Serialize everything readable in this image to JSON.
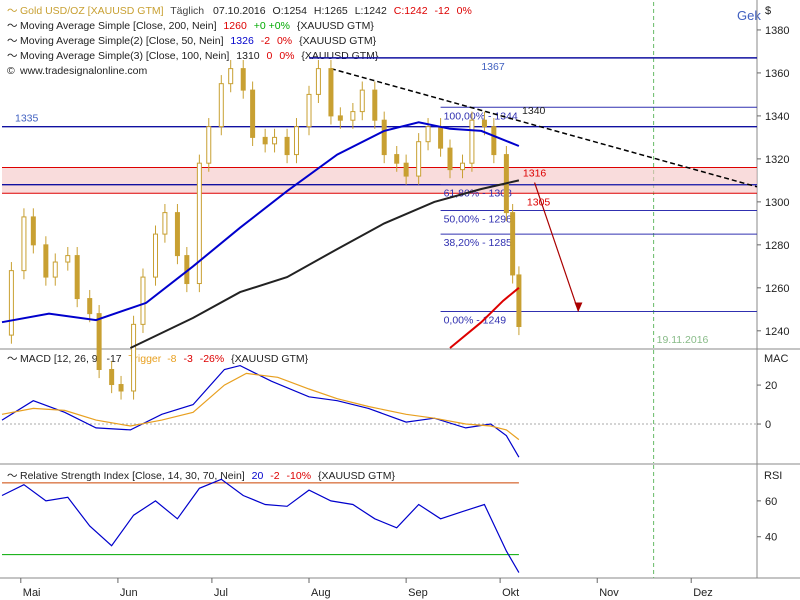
{
  "header": {
    "line1": {
      "name": "Gold USD/OZ [XAUUSD GTM]",
      "meta": "Täglich",
      "date": "07.10.2016",
      "o": "O:1254",
      "h": "H:1265",
      "l": "L:1242",
      "c": "C:1242",
      "chg": "-12",
      "pct": "0%"
    },
    "ma200": {
      "label": "Moving Average Simple [Close, 200, Nein]",
      "value": "1260",
      "chg": "+0",
      "pct": "+0%",
      "src": "{XAUUSD GTM}"
    },
    "ma50": {
      "label": "Moving Average Simple(2) [Close, 50, Nein]",
      "value": "1326",
      "chg": "-2",
      "pct": "0%",
      "src": "{XAUUSD GTM}"
    },
    "ma100": {
      "label": "Moving Average Simple(3) [Close, 100, Nein]",
      "value": "1310",
      "chg": "0",
      "pct": "0%",
      "src": "{XAUUSD GTM}"
    },
    "credit": "www.tradesignalonline.com",
    "corner": "Gek",
    "currency": "$"
  },
  "macd_header": {
    "label": "MACD [12, 26, 9]",
    "value": "-17",
    "trigger_label": "Trigger",
    "trigger": "-8",
    "chg": "-3",
    "pct": "-26%",
    "src": "{XAUUSD GTM}",
    "axis": "MAC"
  },
  "rsi_header": {
    "label": "Relative Strength Index [Close, 14, 30, 70, Nein]",
    "value": "20",
    "chg": "-2",
    "pct": "-10%",
    "src": "{XAUUSD GTM}",
    "axis": "RSI"
  },
  "colors": {
    "candle": "#c8a032",
    "ma50": "#0000cc",
    "ma100": "#222222",
    "ma200": "#dd0000",
    "hline": "#1010a0",
    "fib": "#3030b0",
    "zone": "#f5c4c4",
    "macd": "#0000cc",
    "trigger": "#e8a020",
    "rsi": "#0000cc",
    "vline": "#66bb66"
  },
  "chart_data": [
    {
      "type": "candlestick",
      "price_axis": {
        "ylim": [
          1232,
          1393
        ],
        "ticks": [
          1240,
          1260,
          1280,
          1300,
          1320,
          1340,
          1360,
          1380
        ]
      },
      "time_axis": {
        "xlim": [
          "2016-04-25",
          "2016-12-22"
        ],
        "months": [
          {
            "label": "Mai",
            "date": "2016-05-01"
          },
          {
            "label": "Jun",
            "date": "2016-06-01"
          },
          {
            "label": "Jul",
            "date": "2016-07-01"
          },
          {
            "label": "Aug",
            "date": "2016-08-01"
          },
          {
            "label": "Sep",
            "date": "2016-09-01"
          },
          {
            "label": "Okt",
            "date": "2016-10-01"
          },
          {
            "label": "Nov",
            "date": "2016-11-01"
          },
          {
            "label": "Dez",
            "date": "2016-12-01"
          }
        ]
      },
      "close": [
        [
          "2016-04-25",
          1238
        ],
        [
          "2016-04-28",
          1268
        ],
        [
          "2016-05-02",
          1293
        ],
        [
          "2016-05-05",
          1280
        ],
        [
          "2016-05-09",
          1265
        ],
        [
          "2016-05-12",
          1272
        ],
        [
          "2016-05-16",
          1275
        ],
        [
          "2016-05-19",
          1255
        ],
        [
          "2016-05-23",
          1248
        ],
        [
          "2016-05-26",
          1222
        ],
        [
          "2016-05-30",
          1215
        ],
        [
          "2016-06-02",
          1212
        ],
        [
          "2016-06-06",
          1243
        ],
        [
          "2016-06-09",
          1265
        ],
        [
          "2016-06-13",
          1285
        ],
        [
          "2016-06-16",
          1295
        ],
        [
          "2016-06-20",
          1275
        ],
        [
          "2016-06-23",
          1262
        ],
        [
          "2016-06-27",
          1318
        ],
        [
          "2016-06-30",
          1335
        ],
        [
          "2016-07-04",
          1355
        ],
        [
          "2016-07-07",
          1362
        ],
        [
          "2016-07-11",
          1352
        ],
        [
          "2016-07-14",
          1330
        ],
        [
          "2016-07-18",
          1327
        ],
        [
          "2016-07-21",
          1330
        ],
        [
          "2016-07-25",
          1322
        ],
        [
          "2016-07-28",
          1335
        ],
        [
          "2016-08-01",
          1350
        ],
        [
          "2016-08-04",
          1362
        ],
        [
          "2016-08-08",
          1340
        ],
        [
          "2016-08-11",
          1338
        ],
        [
          "2016-08-15",
          1342
        ],
        [
          "2016-08-18",
          1352
        ],
        [
          "2016-08-22",
          1338
        ],
        [
          "2016-08-25",
          1322
        ],
        [
          "2016-08-29",
          1318
        ],
        [
          "2016-09-01",
          1312
        ],
        [
          "2016-09-05",
          1328
        ],
        [
          "2016-09-08",
          1335
        ],
        [
          "2016-09-12",
          1325
        ],
        [
          "2016-09-15",
          1315
        ],
        [
          "2016-09-19",
          1318
        ],
        [
          "2016-09-22",
          1338
        ],
        [
          "2016-09-26",
          1335
        ],
        [
          "2016-09-29",
          1322
        ],
        [
          "2016-10-03",
          1295
        ],
        [
          "2016-10-05",
          1266
        ],
        [
          "2016-10-07",
          1242
        ]
      ],
      "series": [
        {
          "name": "Moving Average Simple(2) [Close, 50, Nein]",
          "points": [
            [
              "2016-04-25",
              1244
            ],
            [
              "2016-05-10",
              1248
            ],
            [
              "2016-05-25",
              1245
            ],
            [
              "2016-06-10",
              1253
            ],
            [
              "2016-06-25",
              1270
            ],
            [
              "2016-07-10",
              1288
            ],
            [
              "2016-07-25",
              1305
            ],
            [
              "2016-08-10",
              1322
            ],
            [
              "2016-08-25",
              1333
            ],
            [
              "2016-09-05",
              1337
            ],
            [
              "2016-09-15",
              1334
            ],
            [
              "2016-09-25",
              1333
            ],
            [
              "2016-10-07",
              1326
            ]
          ]
        },
        {
          "name": "Moving Average Simple(3) [Close, 100, Nein]",
          "points": [
            [
              "2016-06-05",
              1232
            ],
            [
              "2016-06-25",
              1246
            ],
            [
              "2016-07-10",
              1258
            ],
            [
              "2016-07-25",
              1265
            ],
            [
              "2016-08-10",
              1278
            ],
            [
              "2016-08-25",
              1290
            ],
            [
              "2016-09-10",
              1300
            ],
            [
              "2016-09-25",
              1306
            ],
            [
              "2016-10-07",
              1310
            ]
          ]
        },
        {
          "name": "Moving Average Simple [Close, 200, Nein]",
          "points": [
            [
              "2016-09-15",
              1232
            ],
            [
              "2016-09-25",
              1244
            ],
            [
              "2016-10-02",
              1254
            ],
            [
              "2016-10-07",
              1260
            ]
          ]
        }
      ],
      "levels": [
        {
          "label": "1367",
          "value": 1367,
          "color": "#1010a0"
        },
        {
          "label": "1335",
          "value": 1335,
          "color": "#1010a0"
        },
        {
          "label": "1308",
          "value": 1308,
          "color": "#1010a0"
        }
      ],
      "zone": {
        "from": 1304,
        "to": 1316,
        "labels": [
          "1316",
          "1305"
        ]
      },
      "fib": [
        {
          "label": "100,00% - 1344",
          "value": 1344
        },
        {
          "label": "61,80% - 1308",
          "value": 1308
        },
        {
          "label": "50,00% - 1296",
          "value": 1296
        },
        {
          "label": "38,20% - 1285",
          "value": 1285
        },
        {
          "label": "0,00% - 1249",
          "value": 1249
        }
      ],
      "fib_extra_label": "1340",
      "trendline": {
        "from": [
          "2016-08-08",
          1362
        ],
        "to": [
          "2016-12-22",
          1307
        ]
      },
      "arrow": {
        "from": [
          "2016-10-12",
          1309
        ],
        "to": [
          "2016-10-26",
          1249
        ]
      },
      "vline": {
        "date": "2016-11-19",
        "label": "19.11.2016"
      }
    },
    {
      "type": "line",
      "title": "MACD [12, 26, 9]",
      "ylim": [
        -20,
        38
      ],
      "ticks": [
        0,
        20
      ],
      "series": [
        {
          "name": "MACD",
          "points": [
            [
              "2016-04-25",
              2
            ],
            [
              "2016-05-05",
              12
            ],
            [
              "2016-05-15",
              6
            ],
            [
              "2016-05-25",
              -2
            ],
            [
              "2016-06-05",
              -3
            ],
            [
              "2016-06-15",
              5
            ],
            [
              "2016-06-25",
              10
            ],
            [
              "2016-07-05",
              28
            ],
            [
              "2016-07-10",
              30
            ],
            [
              "2016-07-20",
              22
            ],
            [
              "2016-08-01",
              14
            ],
            [
              "2016-08-10",
              12
            ],
            [
              "2016-08-20",
              8
            ],
            [
              "2016-09-01",
              1
            ],
            [
              "2016-09-10",
              3
            ],
            [
              "2016-09-20",
              -2
            ],
            [
              "2016-09-28",
              0
            ],
            [
              "2016-10-03",
              -6
            ],
            [
              "2016-10-07",
              -17
            ]
          ]
        },
        {
          "name": "Trigger",
          "points": [
            [
              "2016-04-25",
              5
            ],
            [
              "2016-05-05",
              8
            ],
            [
              "2016-05-15",
              7
            ],
            [
              "2016-05-25",
              2
            ],
            [
              "2016-06-05",
              -1
            ],
            [
              "2016-06-15",
              2
            ],
            [
              "2016-06-25",
              6
            ],
            [
              "2016-07-05",
              20
            ],
            [
              "2016-07-12",
              26
            ],
            [
              "2016-07-22",
              24
            ],
            [
              "2016-08-01",
              18
            ],
            [
              "2016-08-10",
              13
            ],
            [
              "2016-08-20",
              9
            ],
            [
              "2016-09-01",
              5
            ],
            [
              "2016-09-10",
              3
            ],
            [
              "2016-09-20",
              0
            ],
            [
              "2016-09-28",
              -1
            ],
            [
              "2016-10-03",
              -3
            ],
            [
              "2016-10-07",
              -8
            ]
          ]
        }
      ]
    },
    {
      "type": "line",
      "title": "Relative Strength Index [Close, 14, 30, 70, Nein]",
      "ylim": [
        17,
        80
      ],
      "ticks": [
        40,
        60
      ],
      "levels": [
        {
          "value": 70,
          "color": "#cc4400"
        },
        {
          "value": 30,
          "color": "#00aa00"
        }
      ],
      "series": [
        {
          "name": "RSI",
          "points": [
            [
              "2016-04-25",
              63
            ],
            [
              "2016-05-02",
              69
            ],
            [
              "2016-05-09",
              60
            ],
            [
              "2016-05-16",
              62
            ],
            [
              "2016-05-23",
              46
            ],
            [
              "2016-05-30",
              35
            ],
            [
              "2016-06-06",
              52
            ],
            [
              "2016-06-13",
              60
            ],
            [
              "2016-06-20",
              50
            ],
            [
              "2016-06-27",
              67
            ],
            [
              "2016-07-04",
              72
            ],
            [
              "2016-07-11",
              63
            ],
            [
              "2016-07-18",
              58
            ],
            [
              "2016-07-25",
              57
            ],
            [
              "2016-08-01",
              66
            ],
            [
              "2016-08-08",
              60
            ],
            [
              "2016-08-15",
              58
            ],
            [
              "2016-08-22",
              50
            ],
            [
              "2016-08-29",
              45
            ],
            [
              "2016-09-05",
              58
            ],
            [
              "2016-09-12",
              50
            ],
            [
              "2016-09-19",
              54
            ],
            [
              "2016-09-26",
              58
            ],
            [
              "2016-10-03",
              32
            ],
            [
              "2016-10-07",
              20
            ]
          ]
        }
      ]
    }
  ]
}
